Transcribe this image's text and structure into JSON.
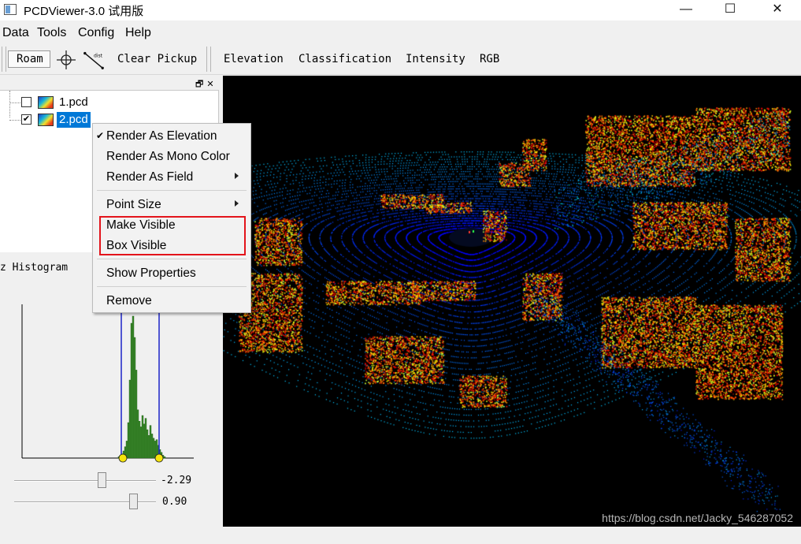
{
  "window": {
    "title": "PCDViewer-3.0 试用版",
    "minimize_glyph": "—",
    "maximize_glyph": "☐",
    "close_glyph": "✕"
  },
  "menubar": [
    "Data",
    "Tools",
    "Config",
    "Help"
  ],
  "toolbar": {
    "roam": "Roam",
    "pick_icon": "crosshair-icon",
    "distance_icon": "distance-measure-icon",
    "distance_icon_text": "dist",
    "clear_pickup": "Clear Pickup",
    "render_modes": [
      "Elevation",
      "Classification",
      "Intensity",
      "RGB"
    ]
  },
  "files": [
    {
      "name": "1.pcd",
      "checked": false,
      "selected": false
    },
    {
      "name": "2.pcd",
      "checked": true,
      "selected": true
    }
  ],
  "histogram": {
    "title": "z Histogram",
    "slider_min_value": "-2.29",
    "slider_max_value": "0.90"
  },
  "context_menu": {
    "render_elevation": "Render As Elevation",
    "render_mono": "Render As Mono Color",
    "render_field": "Render As Field",
    "point_size": "Point Size",
    "make_visible": "Make Visible",
    "box_visible": "Box Visible",
    "show_properties": "Show Properties",
    "remove": "Remove"
  },
  "watermark": "https://blog.csdn.net/Jacky_546287052",
  "colors": {
    "selection": "#0078d7",
    "highlight_box": "#e3141b",
    "viewport_bg": "#000000",
    "histogram_bars": "#3a8a2a",
    "histogram_markers": "#1a22c8"
  }
}
